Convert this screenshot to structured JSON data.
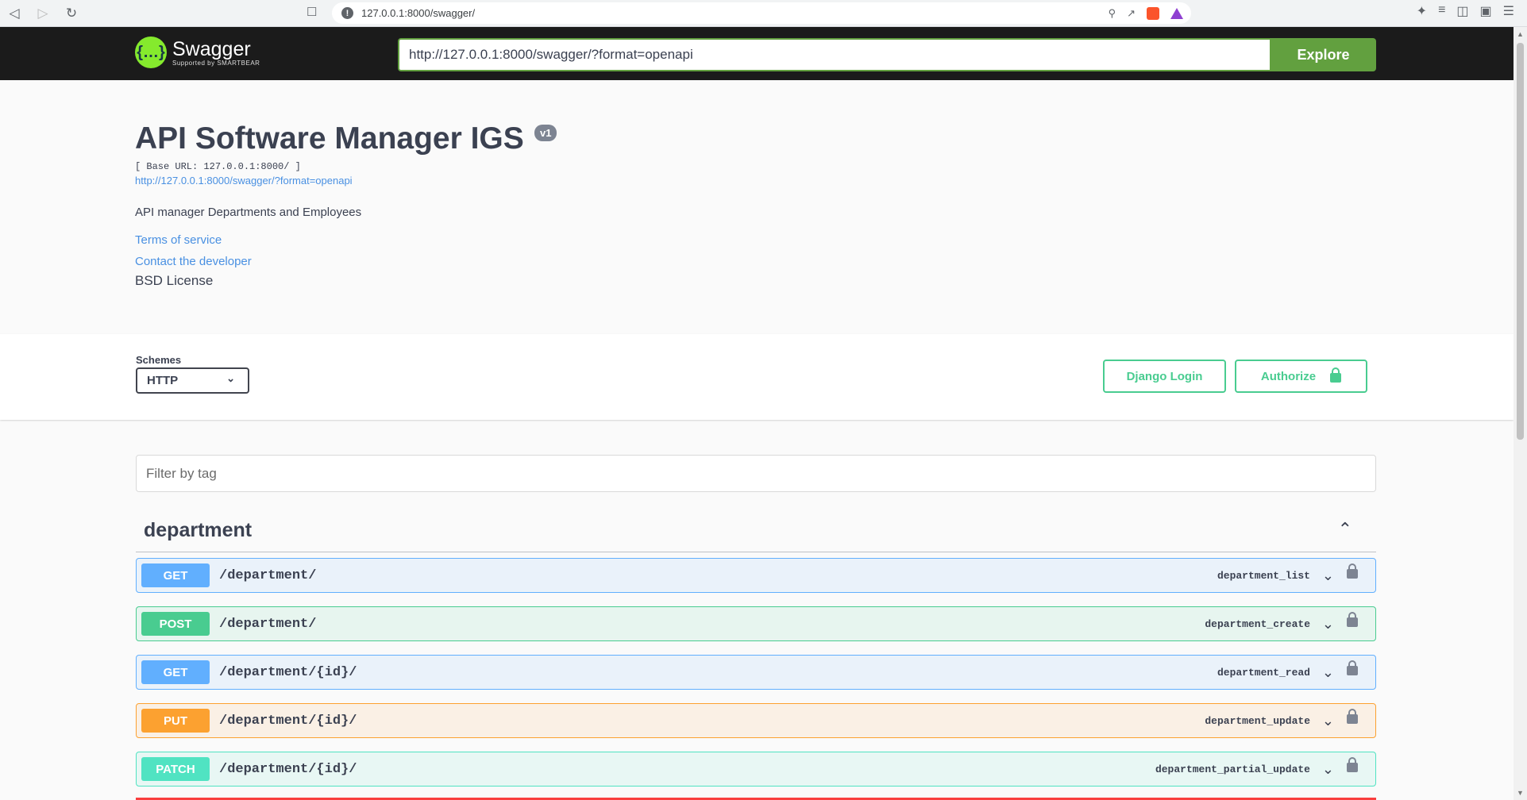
{
  "browser": {
    "url": "127.0.0.1:8000/swagger/"
  },
  "topbar": {
    "logo_text": "Swagger",
    "logo_sub": "Supported by SMARTBEAR",
    "spec_url": "http://127.0.0.1:8000/swagger/?format=openapi",
    "explore_label": "Explore"
  },
  "info": {
    "title": "API Software Manager IGS",
    "version": "v1",
    "base_url": "[ Base URL: 127.0.0.1:8000/ ]",
    "spec_link": "http://127.0.0.1:8000/swagger/?format=openapi",
    "description": "API manager Departments and Employees",
    "terms": "Terms of service",
    "contact": "Contact the developer",
    "license": "BSD License"
  },
  "schemes": {
    "label": "Schemes",
    "selected": "HTTP",
    "django_login": "Django Login",
    "authorize": "Authorize"
  },
  "filter": {
    "placeholder": "Filter by tag"
  },
  "tag": {
    "name": "department"
  },
  "operations": [
    {
      "method": "GET",
      "path": "/department/",
      "opid": "department_list"
    },
    {
      "method": "POST",
      "path": "/department/",
      "opid": "department_create"
    },
    {
      "method": "GET",
      "path": "/department/{id}/",
      "opid": "department_read"
    },
    {
      "method": "PUT",
      "path": "/department/{id}/",
      "opid": "department_update"
    },
    {
      "method": "PATCH",
      "path": "/department/{id}/",
      "opid": "department_partial_update"
    }
  ],
  "colors": {
    "get": "#61affe",
    "post": "#49cc90",
    "put": "#fca130",
    "patch": "#50e3c2",
    "explore": "#62a03f"
  }
}
